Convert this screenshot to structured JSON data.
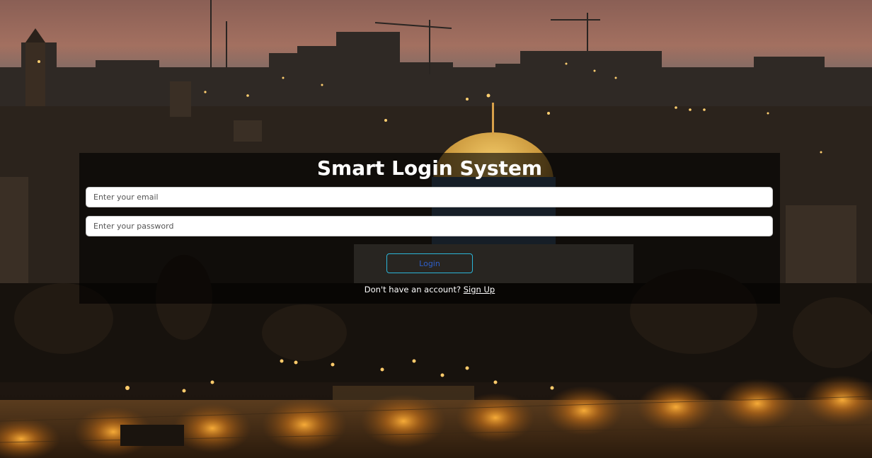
{
  "login": {
    "title": "Smart Login System",
    "email_placeholder": "Enter your email",
    "password_placeholder": "Enter your password",
    "login_label": "Login",
    "no_account_text": "Don't have an account?",
    "signup_label": "Sign Up"
  },
  "colors": {
    "panel_overlay": "#000000",
    "button_border": "#2bb5d8",
    "button_text": "#2f5fc9",
    "title_text": "#ffffff"
  }
}
